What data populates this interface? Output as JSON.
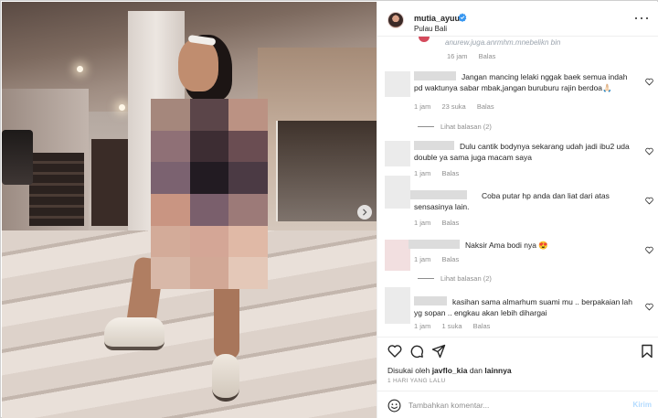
{
  "post": {
    "username": "mutia_ayuu",
    "location": "Pulau Bali",
    "verified": true
  },
  "top_truncated": {
    "text": "anurew.juga.anrmhm.mnebelikn bin",
    "time": "16 jam",
    "reply": "Balas"
  },
  "comments": [
    {
      "text": "Jangan mancing lelaki nggak baek semua indah pd waktunya sabar mbak,jangan buruburu rajin berdoa🙏🏻",
      "time": "1 jam",
      "likes": "23 suka",
      "reply": "Balas",
      "view_replies": "Lihat balasan (2)"
    },
    {
      "text": "Dulu cantik bodynya sekarang udah jadi ibu2 uda double ya sama juga macam saya",
      "time": "1 jam",
      "likes": "",
      "reply": "Balas",
      "view_replies": ""
    },
    {
      "text": "Coba putar hp anda dan liat dari atas sensasinya lain.",
      "time": "1 jam",
      "likes": "",
      "reply": "Balas",
      "view_replies": ""
    },
    {
      "text": "Naksir Ama bodi nya 😍",
      "time": "1 jam",
      "likes": "",
      "reply": "Balas",
      "view_replies": "Lihat balasan (2)"
    },
    {
      "text": "kasihan sama almarhum suami mu .. berpakaian lah yg sopan .. engkau akan lebih dihargai",
      "time": "1 jam",
      "likes": "1 suka",
      "reply": "Balas",
      "view_replies": ""
    }
  ],
  "liked_by": {
    "prefix": "Disukai oleh",
    "user": "javflo_kia",
    "conj": "dan",
    "others": "lainnya"
  },
  "date": "1 HARI YANG LALU",
  "composer": {
    "placeholder": "Tambahkan komentar...",
    "post_label": "Kirim"
  },
  "icons": {
    "verified": "verified-badge-icon",
    "more": "more-options-icon",
    "like": "heart-icon",
    "comment": "comment-icon",
    "share": "share-icon",
    "save": "bookmark-icon",
    "emoji": "emoji-icon",
    "next": "chevron-right-icon"
  },
  "colors": {
    "verified": "#3897f0",
    "post_disabled": "#b3dbff",
    "meta_text": "#8e8e8e"
  }
}
